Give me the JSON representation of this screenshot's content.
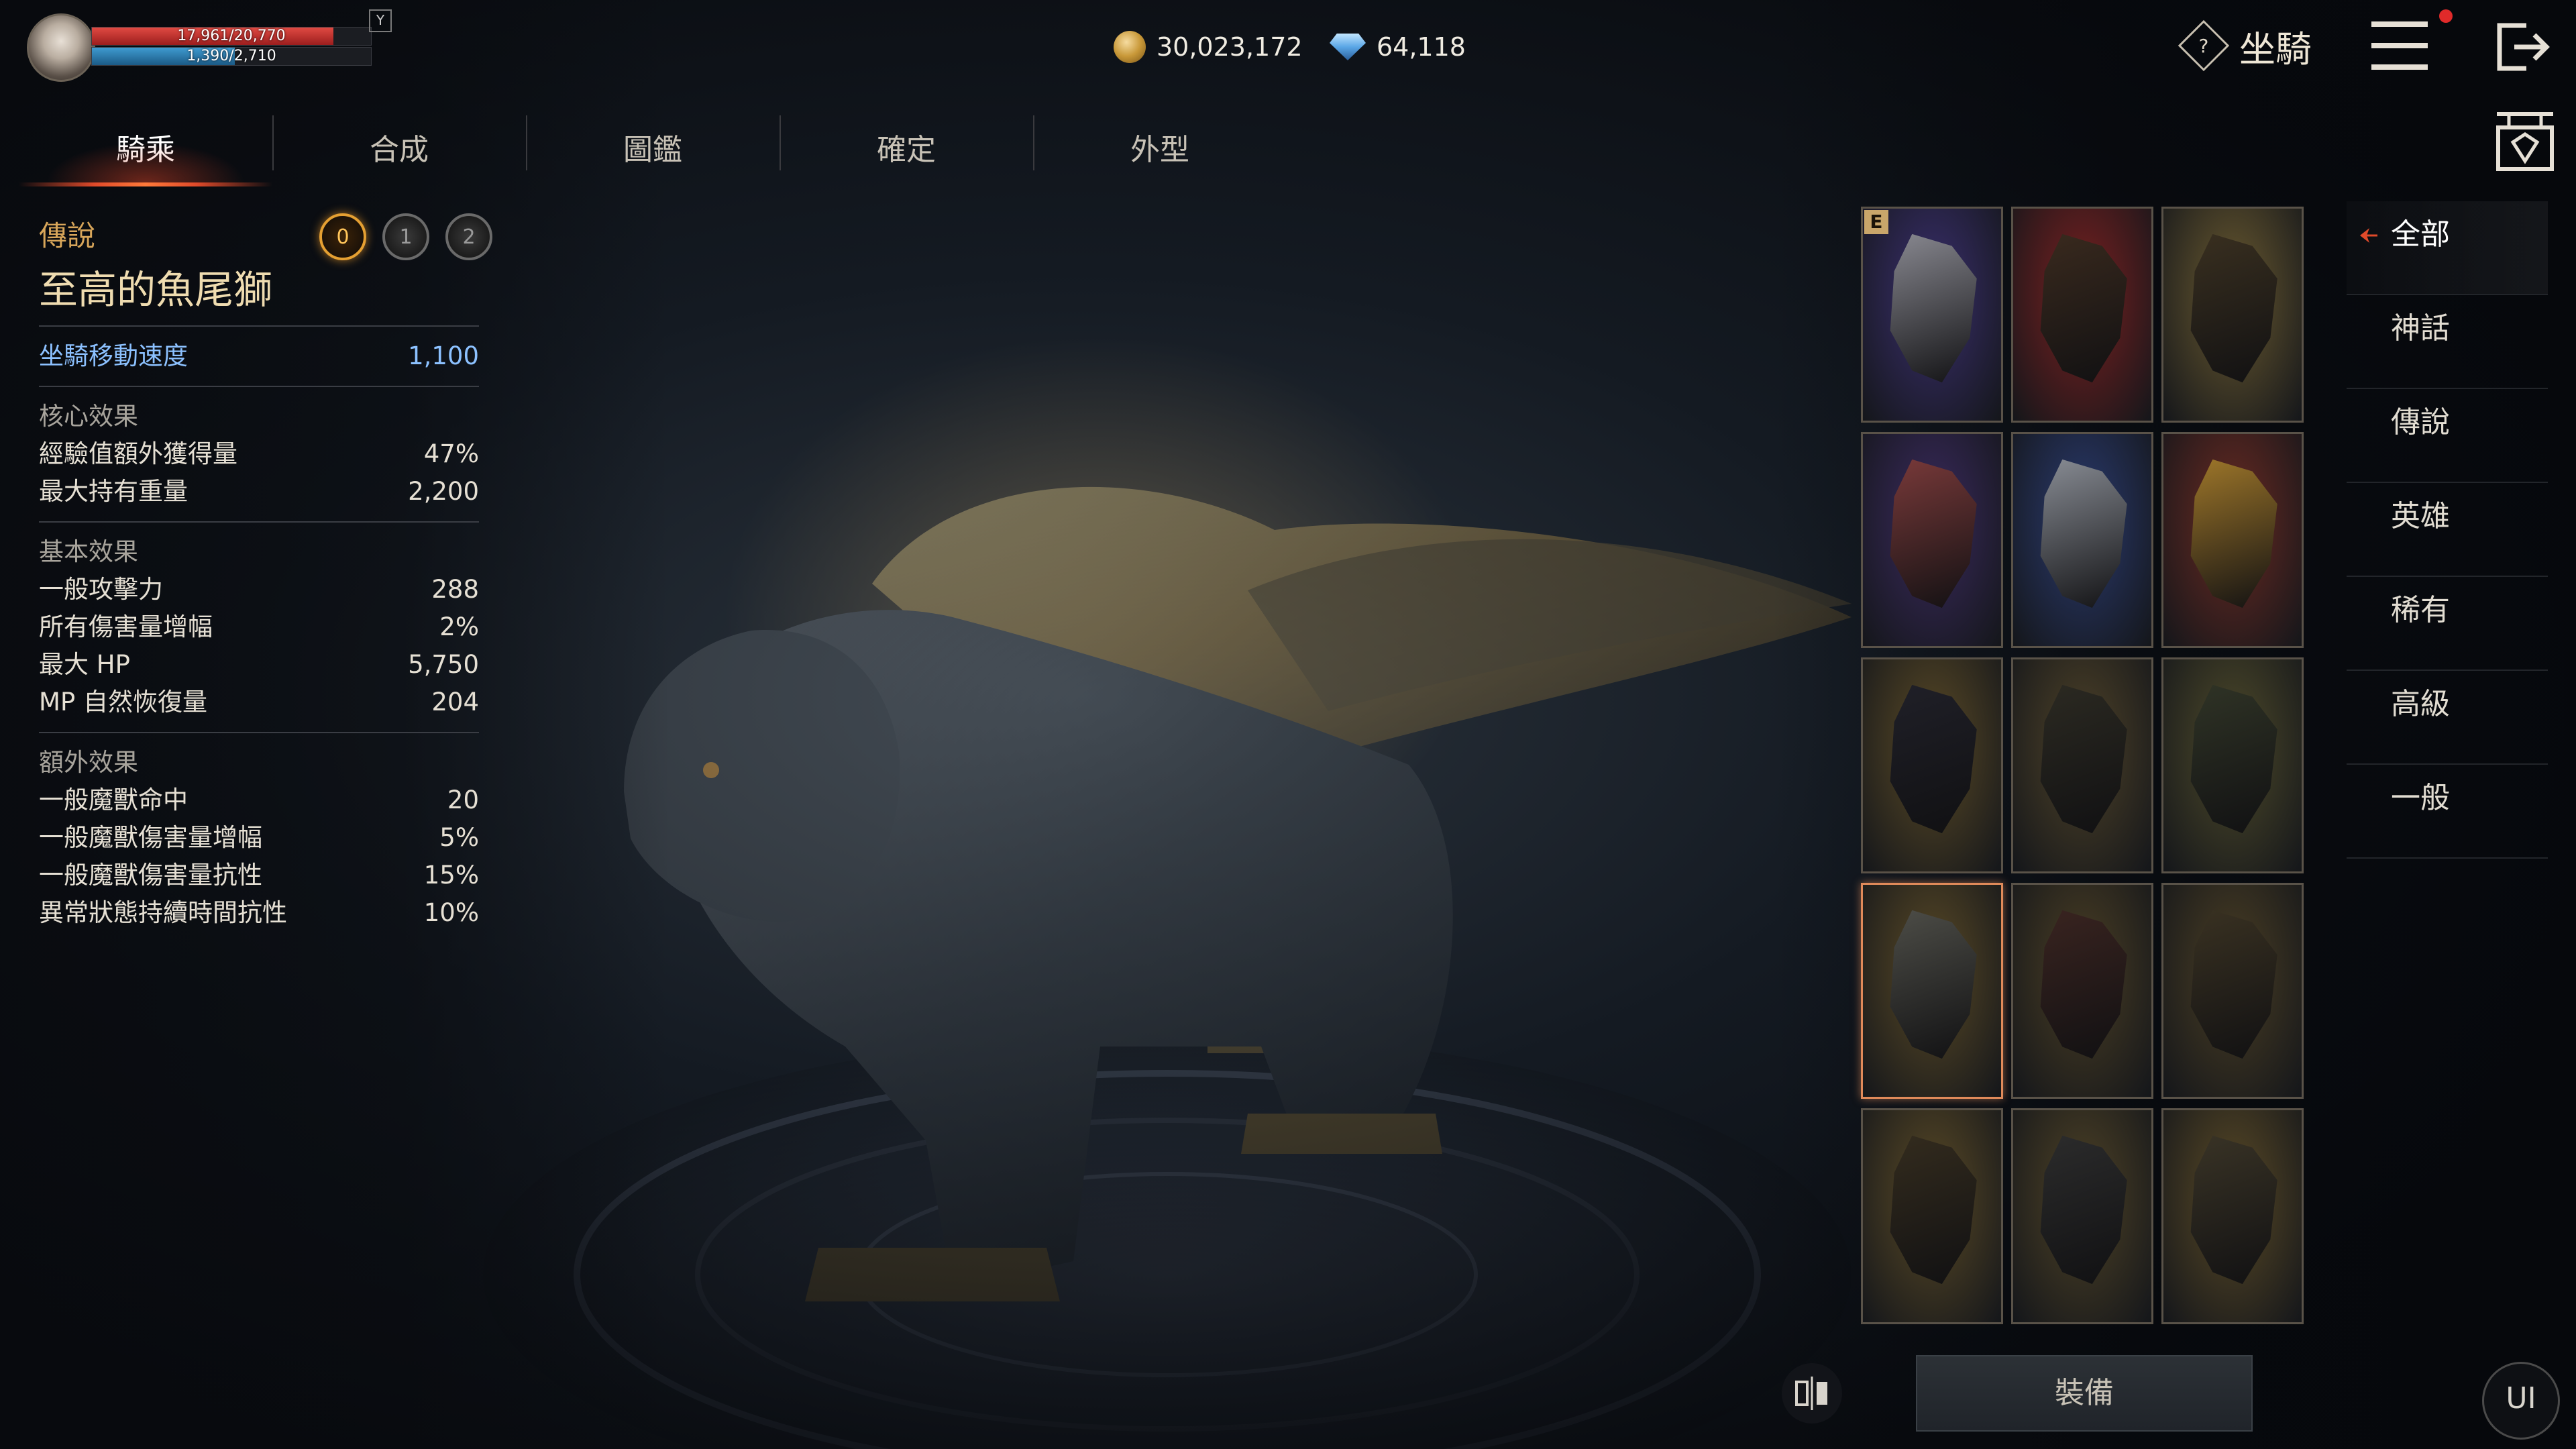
{
  "player": {
    "hp_text": "17,961/20,770",
    "hp_fraction": 0.865,
    "mp_text": "1,390/2,710",
    "mp_fraction": 0.513,
    "hotkey": "Y"
  },
  "currency": {
    "gold": "30,023,172",
    "diamonds": "64,118"
  },
  "header": {
    "title": "坐騎",
    "help_icon": "?"
  },
  "tabs": [
    {
      "label": "騎乘",
      "active": true
    },
    {
      "label": "合成"
    },
    {
      "label": "圖鑑"
    },
    {
      "label": "確定"
    },
    {
      "label": "外型"
    }
  ],
  "mount": {
    "grade": "傳說",
    "name": "至高的魚尾獅",
    "stages": [
      "0",
      "1",
      "2"
    ],
    "move_speed_label": "坐騎移動速度",
    "move_speed_value": "1,100"
  },
  "core_effects": {
    "title": "核心效果",
    "items": [
      {
        "label": "經驗值額外獲得量",
        "value": "47%"
      },
      {
        "label": "最大持有重量",
        "value": "2,200"
      }
    ]
  },
  "basic_effects": {
    "title": "基本效果",
    "items": [
      {
        "label": "一般攻擊力",
        "value": "288"
      },
      {
        "label": "所有傷害量增幅",
        "value": "2%"
      },
      {
        "label": "最大 HP",
        "value": "5,750"
      },
      {
        "label": "MP 自然恢復量",
        "value": "204"
      }
    ]
  },
  "extra_effects": {
    "title": "額外效果",
    "items": [
      {
        "label": "一般魔獸命中",
        "value": "20"
      },
      {
        "label": "一般魔獸傷害量增幅",
        "value": "5%"
      },
      {
        "label": "一般魔獸傷害量抗性",
        "value": "15%"
      },
      {
        "label": "異常狀態持續時間抗性",
        "value": "10%"
      }
    ]
  },
  "grid": {
    "equipped_badge": "E",
    "cards": [
      {
        "bg": "#3a2f6e",
        "beast": "#8a8a92",
        "equipped": true
      },
      {
        "bg": "#7a2020",
        "beast": "#3a2a1e"
      },
      {
        "bg": "#6a5a30",
        "beast": "#3a3020"
      },
      {
        "bg": "#3a2a5e",
        "beast": "#7a3a3a"
      },
      {
        "bg": "#2a3a6e",
        "beast": "#8a8e96"
      },
      {
        "bg": "#6a2a22",
        "beast": "#a0782a"
      },
      {
        "bg": "#5a4a26",
        "beast": "#202028"
      },
      {
        "bg": "#4e4228",
        "beast": "#2c2a22"
      },
      {
        "bg": "#4e4a2a",
        "beast": "#303426"
      },
      {
        "bg": "#5a4a26",
        "beast": "#4e4e48",
        "selected": true
      },
      {
        "bg": "#4a3e24",
        "beast": "#3a2420"
      },
      {
        "bg": "#4a3e24",
        "beast": "#3a3222"
      },
      {
        "bg": "#5a4a26",
        "beast": "#342c1e"
      },
      {
        "bg": "#4e4226",
        "beast": "#2c2c2c"
      },
      {
        "bg": "#5a4a26",
        "beast": "#3a3426"
      }
    ]
  },
  "categories": [
    {
      "label": "全部",
      "active": true
    },
    {
      "label": "神話"
    },
    {
      "label": "傳說"
    },
    {
      "label": "英雄"
    },
    {
      "label": "稀有"
    },
    {
      "label": "高級"
    },
    {
      "label": "一般"
    }
  ],
  "buttons": {
    "equip": "裝備",
    "ui": "UI"
  },
  "colors": {
    "accent_red": "#e04a2a",
    "gold_text": "#d8a65a",
    "selected_border": "#e08a5a",
    "key_stat": "#8cc1ff"
  }
}
